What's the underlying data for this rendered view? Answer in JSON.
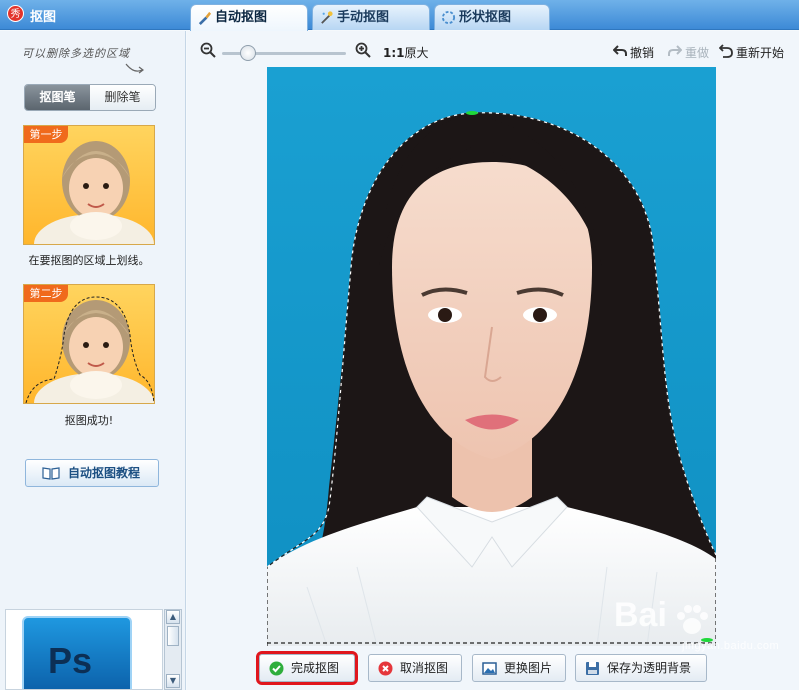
{
  "app": {
    "title": "抠图",
    "logo_text": "秀"
  },
  "tabs": [
    {
      "label": "自动抠图",
      "active": true
    },
    {
      "label": "手动抠图",
      "active": false
    },
    {
      "label": "形状抠图",
      "active": false
    }
  ],
  "sidebar": {
    "hint": "可以删除多选的区域",
    "mode_buttons": [
      {
        "label": "抠图笔"
      },
      {
        "label": "删除笔"
      }
    ],
    "steps": [
      {
        "badge": "第一步",
        "caption": "在要抠图的区域上划线。"
      },
      {
        "badge": "第二步",
        "caption": "抠图成功!"
      }
    ],
    "tutorial_label": "自动抠图教程",
    "thumb_icon_text": "Ps"
  },
  "toolbar": {
    "ratio_label": "1:1",
    "original_label": "原大",
    "undo_label": "撤销",
    "redo_label": "重做",
    "restart_label": "重新开始"
  },
  "bottom": {
    "finish_label": "完成抠图",
    "cancel_label": "取消抠图",
    "replace_label": "更换图片",
    "save_label": "保存为透明背景"
  },
  "watermark": {
    "text": "Bai",
    "sub": "jingyan.baidu.com"
  },
  "colors": {
    "accent": "#3d8ad6",
    "highlight": "#e0161d",
    "photo_bg": "#1197c9",
    "step_badge": "#f06a1c"
  }
}
